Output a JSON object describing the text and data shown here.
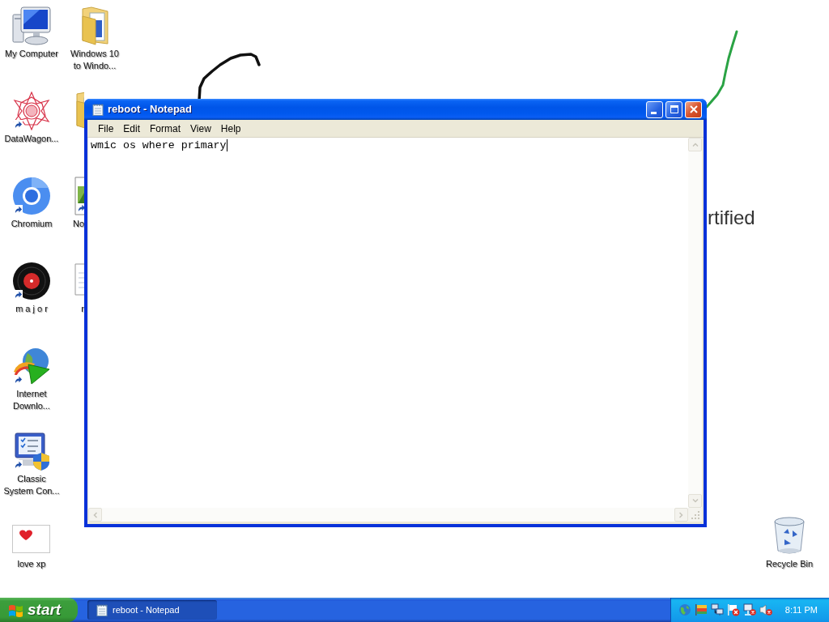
{
  "desktop": {
    "wallpaper_text": "rtified",
    "icon_columns": [
      [
        {
          "kind": "computer",
          "label": [
            "My Computer"
          ],
          "shortcut": false,
          "partly_hidden": false
        },
        {
          "kind": "star",
          "label": [
            "DataWagon..."
          ],
          "shortcut": true,
          "partly_hidden": false
        },
        {
          "kind": "browser",
          "label": [
            "Chromium"
          ],
          "shortcut": true,
          "partly_hidden": false
        },
        {
          "kind": "disc",
          "label": [
            "m a j o r"
          ],
          "shortcut": true,
          "partly_hidden": false
        },
        {
          "kind": "download",
          "label": [
            "Internet",
            "Downlo..."
          ],
          "shortcut": true,
          "partly_hidden": false
        },
        {
          "kind": "system",
          "label": [
            "Classic",
            "System Con..."
          ],
          "shortcut": true,
          "partly_hidden": false
        },
        {
          "kind": "heart",
          "label": [
            "love xp"
          ],
          "shortcut": false,
          "partly_hidden": false
        }
      ],
      [
        {
          "kind": "folder",
          "label": [
            "Windows 10",
            "to Windo..."
          ],
          "shortcut": false,
          "partly_hidden": false
        },
        {
          "kind": "folder",
          "shortcut": false,
          "partly_hidden": true
        },
        {
          "kind": "picture",
          "label": [
            "No"
          ],
          "shortcut": true,
          "partly_hidden": true
        },
        {
          "kind": "document",
          "label": [
            "r"
          ],
          "shortcut": false,
          "partly_hidden": true
        }
      ]
    ],
    "recycle_bin": {
      "kind": "recycle",
      "label": [
        "Recycle Bin"
      ],
      "shortcut": false,
      "partly_hidden": false
    }
  },
  "window": {
    "title": "reboot - Notepad",
    "active": true,
    "menu": [
      "File",
      "Edit",
      "Format",
      "View",
      "Help"
    ],
    "text": "wmic os where primary",
    "focused": true
  },
  "taskbar": {
    "start": "start",
    "tasks": [
      {
        "label": "reboot - Notepad",
        "selected": true
      }
    ],
    "clock": "8:11 PM"
  }
}
